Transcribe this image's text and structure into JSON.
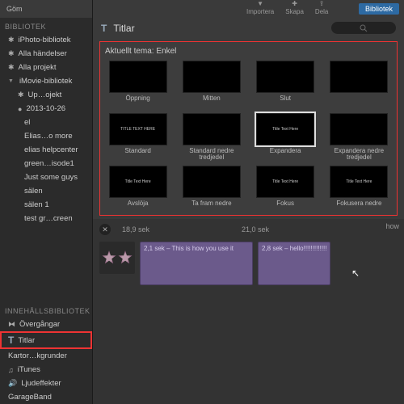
{
  "toolbar": {
    "hide": "Göm",
    "import": "Importera",
    "create": "Skapa",
    "share": "Dela",
    "library": "Bibliotek"
  },
  "sidebar": {
    "section": "BIBLIOTEK",
    "items": [
      "iPhoto-bibliotek",
      "Alla händelser",
      "Alla projekt",
      "iMovie-bibliotek",
      "Up…ojekt",
      "2013-10-26",
      "el",
      "Elias…o more",
      "elias helpcenter",
      "green…isode1",
      "Just some guys",
      "sälen",
      "sälen 1",
      "test gr…creen"
    ],
    "contentSection": "INNEHÅLLSBIBLIOTEK",
    "content": [
      "Övergångar",
      "Titlar",
      "Kartor…kgrunder",
      "iTunes",
      "Ljudeffekter",
      "GarageBand"
    ]
  },
  "titles": {
    "header": "Titlar",
    "theme": "Aktuellt tema: Enkel",
    "tiles": [
      {
        "thumb": "",
        "label": "Öppning"
      },
      {
        "thumb": "",
        "label": "Mitten"
      },
      {
        "thumb": "",
        "label": "Slut"
      },
      {
        "thumb": "",
        "label": ""
      },
      {
        "thumb": "TITLE TEXT HERE",
        "label": "Standard"
      },
      {
        "thumb": "",
        "label": "Standard nedre tredjedel"
      },
      {
        "thumb": "Title Text Here",
        "label": "Expandera"
      },
      {
        "thumb": "",
        "label": "Expandera nedre tredjedel"
      },
      {
        "thumb": "Title Text Here",
        "label": "Avslöja"
      },
      {
        "thumb": "",
        "label": "Ta fram nedre"
      },
      {
        "thumb": "Title Text Here",
        "label": "Fokus"
      },
      {
        "thumb": "Title Text Here",
        "label": "Fokusera nedre"
      }
    ]
  },
  "timeline": {
    "marks": [
      "18,9 sek",
      "21,0 sek"
    ],
    "how": "how",
    "clips": [
      "2,1 sek – This is how you use it",
      "2,8 sek – hello!!!!!!!!!!!!!"
    ]
  }
}
